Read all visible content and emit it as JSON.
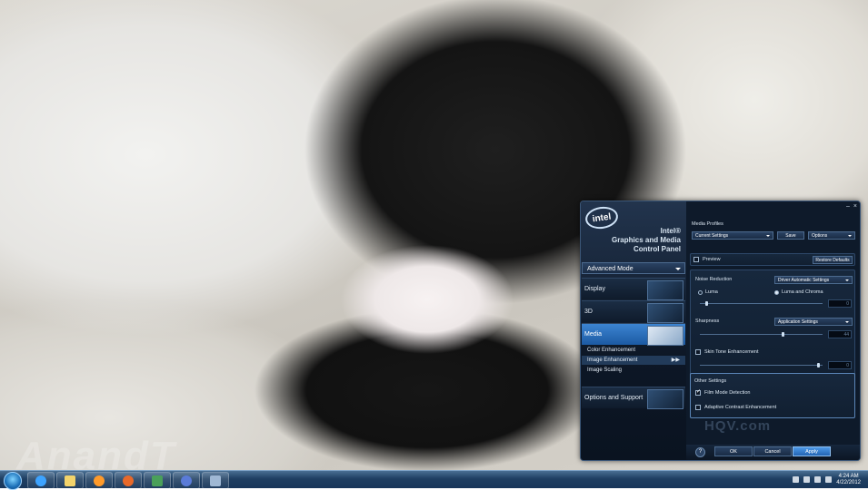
{
  "wallpaper": {
    "watermark": "AnandT"
  },
  "panel": {
    "logo": "intel",
    "brand": [
      "Intel®",
      "Graphics and Media",
      "Control Panel"
    ],
    "mode": "Advanced Mode",
    "nav": [
      {
        "label": "Display"
      },
      {
        "label": "3D"
      },
      {
        "label": "Media"
      },
      {
        "label": "Options and Support"
      }
    ],
    "media_sub": [
      "Color Enhancement",
      "Image Enhancement",
      "Image Scaling"
    ],
    "window_controls": {
      "minimize": "–",
      "close": "×"
    },
    "profiles": {
      "title": "Media Profiles",
      "current": "Current Settings",
      "save": "Save",
      "options": "Options"
    },
    "preview": {
      "label": "Preview",
      "restore": "Restore Defaults"
    },
    "noise": {
      "label": "Noise Reduction",
      "mode": "Driver Automatic Settings",
      "luma": "Luma",
      "luma_chroma": "Luma and Chroma",
      "value": "0"
    },
    "sharpness": {
      "label": "Sharpness",
      "mode": "Application Settings",
      "value": "44"
    },
    "skin": {
      "label": "Skin Tone Enhancement",
      "value": "0"
    },
    "other": {
      "title": "Other Settings",
      "film": "Film Mode Detection",
      "adaptive": "Adaptive Contrast Enhancement"
    },
    "hqv": "HQV.com",
    "footer": {
      "help": "?",
      "ok": "OK",
      "cancel": "Cancel",
      "apply": "Apply"
    }
  },
  "taskbar": {
    "clock_time": "4:24 AM",
    "clock_date": "4/22/2012",
    "apps": [
      "ie-icon",
      "explorer-icon",
      "media-player-icon",
      "firefox-icon",
      "app-icon",
      "media-center-icon",
      "display-icon"
    ]
  }
}
